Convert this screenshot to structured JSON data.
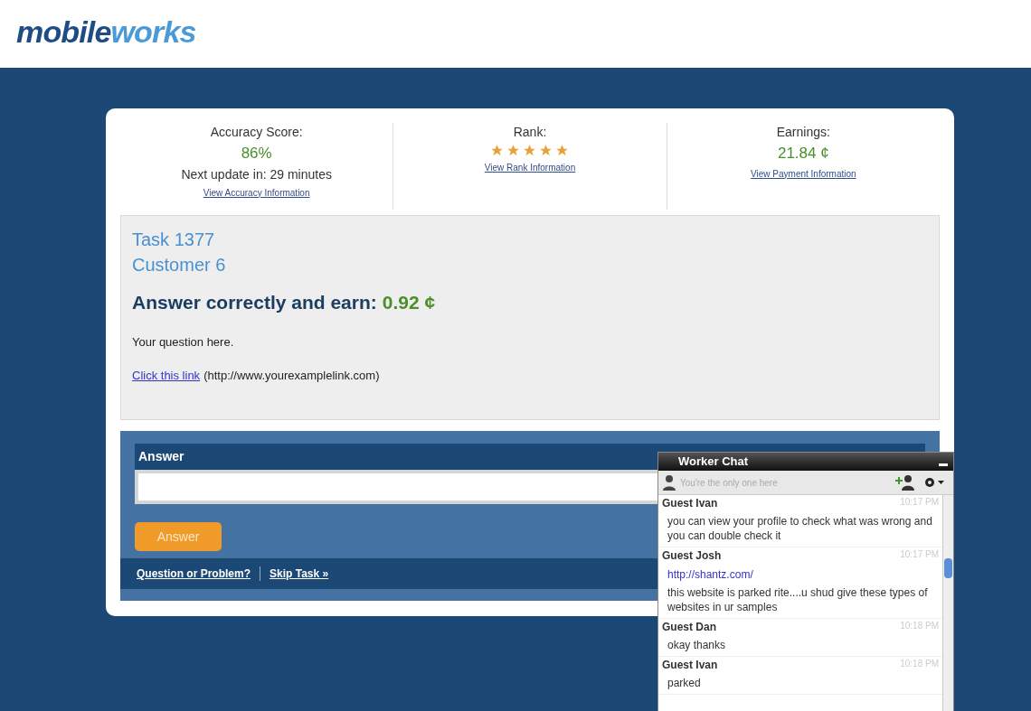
{
  "logo": {
    "part1": "mobile",
    "part2": "works"
  },
  "stats": [
    {
      "kind": "text",
      "label": "Accuracy Score:",
      "value": "86%",
      "note": "Next update in: 29 minutes",
      "link": "View Accuracy Information"
    },
    {
      "kind": "stars",
      "label": "Rank:",
      "stars": 5,
      "link": "View Rank Information"
    },
    {
      "kind": "text",
      "label": "Earnings:",
      "value": "21.84 ¢",
      "link": "View Payment Information"
    }
  ],
  "task": {
    "title": "Task 1377",
    "customer": "Customer 6",
    "earn_label": "Answer correctly and earn:",
    "earn_value": "0.92 ¢",
    "question": "Your question here.",
    "link": "Click this link",
    "link_note": "(http://www.yourexamplelink.com)"
  },
  "answer": {
    "heading": "Answer",
    "button": "Answer",
    "footer_links": [
      "Question or Problem?",
      "Skip Task »"
    ]
  },
  "chat": {
    "title": "Worker Chat",
    "status": "You're the only one here",
    "messages": [
      {
        "author": "Guest Ivan",
        "time": "10:17 PM",
        "lines": [
          {
            "kind": "text",
            "text": "you can view your profile to check what was wrong and you can double check it"
          }
        ]
      },
      {
        "author": "Guest Josh",
        "time": "10:17 PM",
        "lines": [
          {
            "kind": "link",
            "text": "http://shantz.com/"
          },
          {
            "kind": "text",
            "text": "this website is parked rite....u shud give these types of websites in ur samples"
          }
        ]
      },
      {
        "author": "Guest Dan",
        "time": "10:18 PM",
        "lines": [
          {
            "kind": "text",
            "text": "okay thanks"
          }
        ]
      },
      {
        "author": "Guest Ivan",
        "time": "10:18 PM",
        "lines": [
          {
            "kind": "text",
            "text": "parked"
          }
        ]
      }
    ]
  }
}
